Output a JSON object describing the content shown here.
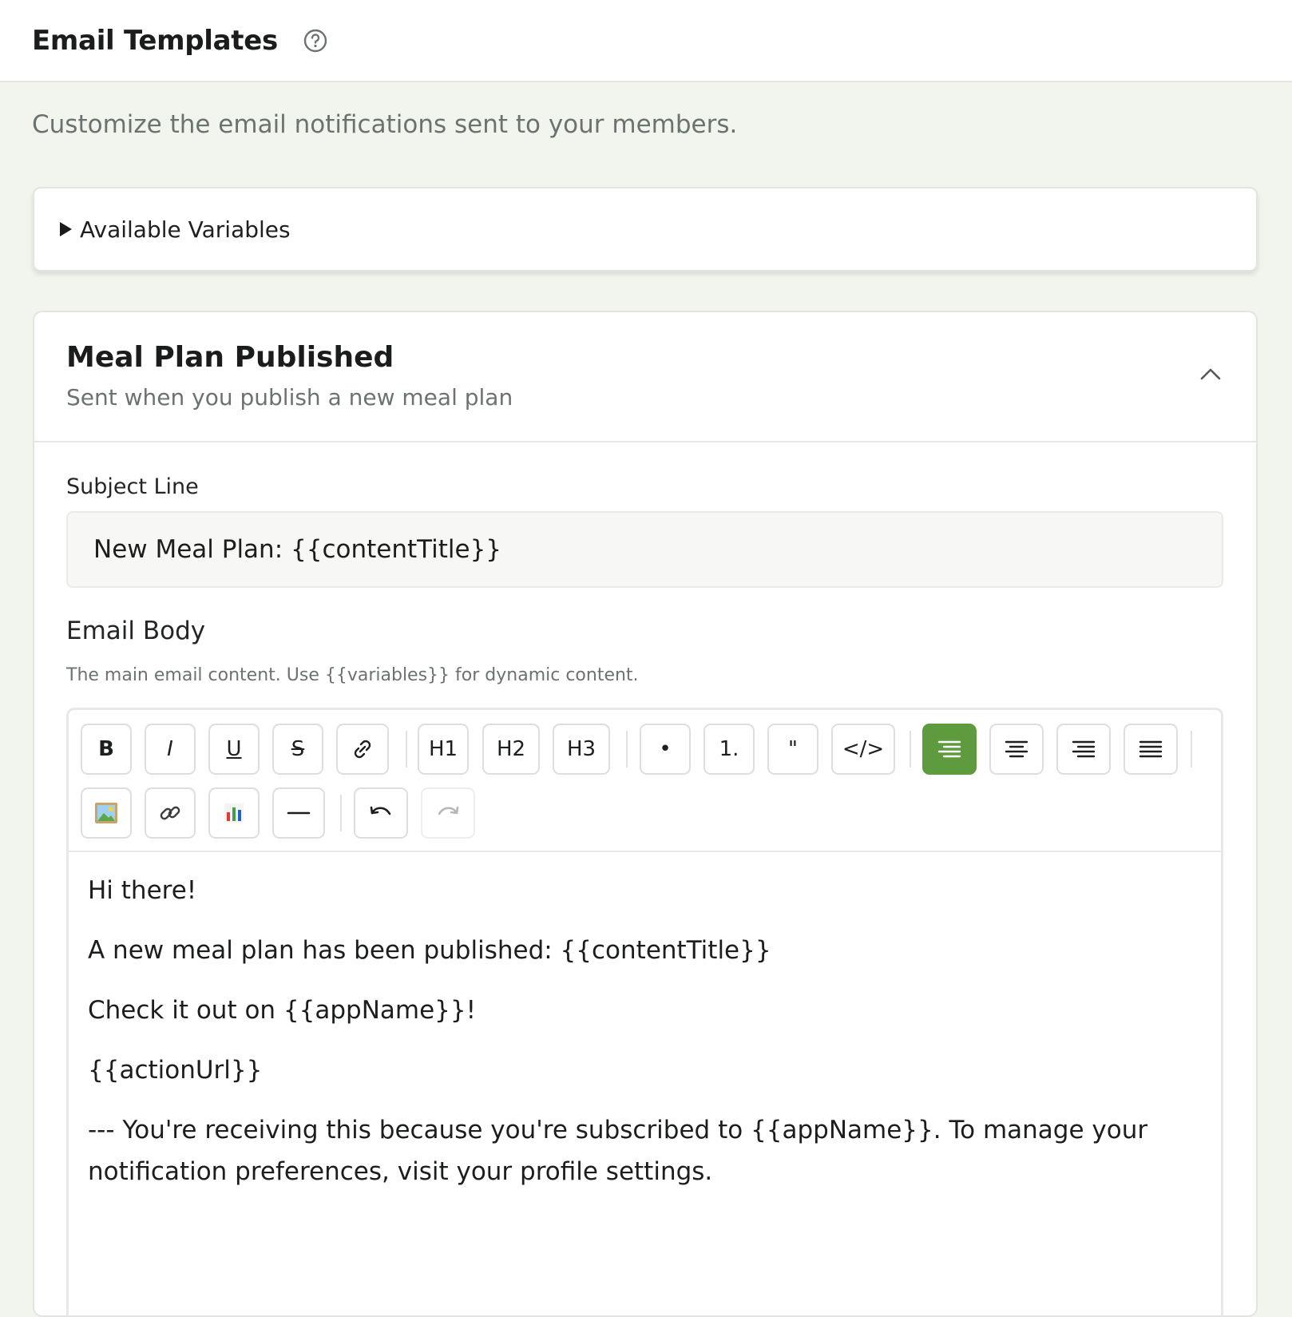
{
  "header": {
    "title": "Email Templates",
    "help_icon": "help-circle-icon"
  },
  "intro": "Customize the email notifications sent to your members.",
  "variables_panel": {
    "label": "Available Variables",
    "expanded": false
  },
  "template": {
    "title": "Meal Plan Published",
    "subtitle": "Sent when you publish a new meal plan",
    "collapse_icon": "chevron-up-icon",
    "subject_label": "Subject Line",
    "subject_value": "New Meal Plan: {{contentTitle}}",
    "body_label": "Email Body",
    "body_hint": "The main email content. Use {{variables}} for dynamic content.",
    "toolbar": {
      "bold": "B",
      "italic": "I",
      "underline": "U",
      "strike": "S",
      "h1": "H1",
      "h2": "H2",
      "h3": "H3",
      "bullet": "•",
      "ordered": "1.",
      "quote": "\"",
      "code": "</>",
      "active_color": "#5e9a3e"
    },
    "body": {
      "p1": "Hi there!",
      "p2": "A new meal plan has been published: {{contentTitle}}",
      "p3": "Check it out on {{appName}}!",
      "p4": "{{actionUrl}}",
      "p5": "--- You're receiving this because you're subscribed to {{appName}}. To manage your notification preferences, visit your profile settings."
    }
  }
}
